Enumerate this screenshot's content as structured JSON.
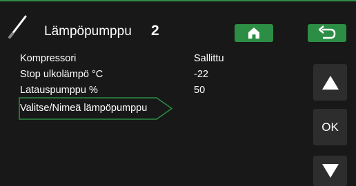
{
  "header": {
    "title": "Lämpöpumppu",
    "number": "2",
    "icon": "settings-pencil-icon",
    "home_icon": "home-icon",
    "back_icon": "back-arrow-icon"
  },
  "rows": [
    {
      "label": "Kompressori",
      "value": "Sallittu"
    },
    {
      "label": "Stop ulkolämpö °C",
      "value": "-22"
    },
    {
      "label": "Latauspumppu %",
      "value": "50"
    }
  ],
  "selected_item": {
    "label": "Valitse/Nimeä lämpöpumppu"
  },
  "side_buttons": {
    "up_icon": "triangle-up-icon",
    "ok_label": "OK",
    "down_icon": "triangle-down-icon"
  },
  "colors": {
    "accent": "#2c8d44",
    "background": "#181818",
    "button": "#2d2d2d"
  }
}
